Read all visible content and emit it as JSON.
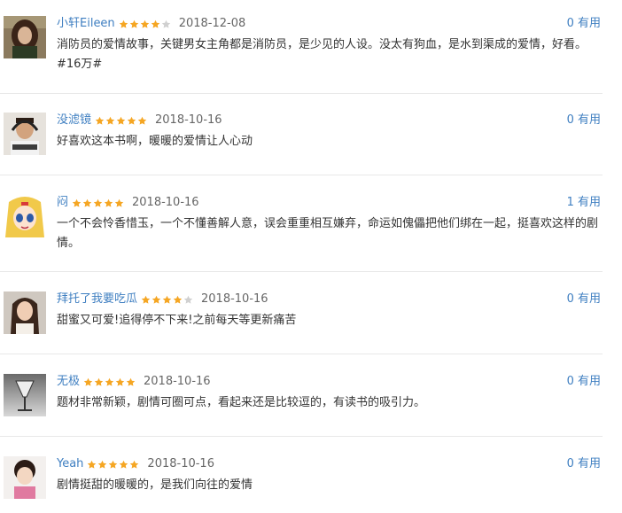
{
  "reviews": [
    {
      "username": "小轩Eileen",
      "rating": 4,
      "date": "2018-12-08",
      "content": "消防员的爱情故事，关键男女主角都是消防员，是少见的人设。没太有狗血，是水到渠成的爱情，好看。#16万#",
      "useful": "0 有用",
      "avatar": "brunette-woman-avatar"
    },
    {
      "username": "没滤镜",
      "rating": 5,
      "date": "2018-10-16",
      "content": "好喜欢这本书啊，暖暖的爱情让人心动",
      "useful": "0 有用",
      "avatar": "man-headphones-avatar"
    },
    {
      "username": "闷",
      "rating": 5,
      "date": "2018-10-16",
      "content": "一个不会怜香惜玉，一个不懂善解人意，误会重重相互嫌弃，命运如傀儡把他们绑在一起，挺喜欢这样的剧情。",
      "useful": "1 有用",
      "avatar": "anime-girl-avatar"
    },
    {
      "username": "拜托了我要吃瓜",
      "rating": 4,
      "date": "2018-10-16",
      "content": "甜蜜又可爱!追得停不下来!之前每天等更新痛苦",
      "useful": "0 有用",
      "avatar": "girl-long-hair-avatar"
    },
    {
      "username": "无极",
      "rating": 5,
      "date": "2018-10-16",
      "content": "题材非常新颖，剧情可圈可点，看起来还是比较逗的，有读书的吸引力。",
      "useful": "0 有用",
      "avatar": "wine-glass-avatar"
    },
    {
      "username": "Yeah",
      "rating": 5,
      "date": "2018-10-16",
      "content": "剧情挺甜的暖暖的，是我们向往的爱情",
      "useful": "0 有用",
      "avatar": "child-avatar"
    }
  ],
  "colors": {
    "username": "#3f7fc1",
    "useful": "#3f7fc1",
    "star_filled": "#f5a623",
    "star_empty": "#d0d0d0",
    "divider": "#e8e8e8"
  }
}
